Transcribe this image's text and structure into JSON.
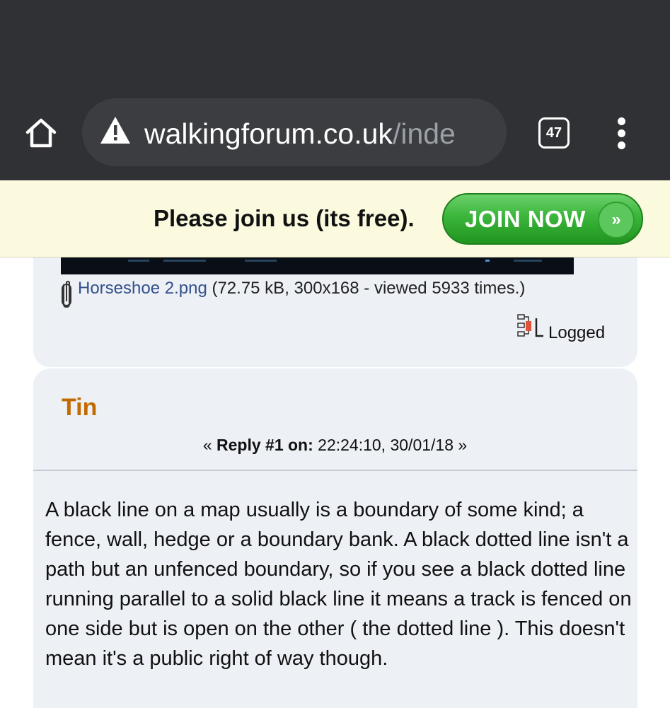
{
  "browser": {
    "url_domain": "walkingforum.co.uk",
    "url_path": "/inde",
    "tab_count": "47",
    "icons": [
      "home-icon",
      "not-secure-warning-icon",
      "tab-switcher-icon",
      "overflow-menu-icon"
    ]
  },
  "banner": {
    "text": "Please join us (its free).",
    "button_label": "JOIN NOW",
    "button_chevron": "»"
  },
  "previous_post": {
    "attachment_name": "Horseshoe 2.png",
    "attachment_meta": " (72.75 kB, 300x168 - viewed 5933 times.)",
    "logged_label": "Logged"
  },
  "post": {
    "author": "Tin",
    "reply_open": "« ",
    "reply_label": "Reply #1 on:",
    "reply_time": " 22:24:10, 30/01/18 »",
    "body": "A black line on a map usually is a boundary of some kind; a fence, wall, hedge or a boundary bank. A black dotted line isn't a path but an unfenced boundary, so if you see a black dotted line running parallel to a solid black line it means a track is fenced on one side but is open on the other ( the dotted line ). This doesn't mean it's a public right of way though."
  },
  "colors": {
    "toolbar": "#303134",
    "urlbar": "#3c3d40",
    "banner_bg": "#fbfadf",
    "join_green": "#3bb53b",
    "author": "#c26a00",
    "link": "#33508c",
    "post_bg": "#edf0f5"
  }
}
